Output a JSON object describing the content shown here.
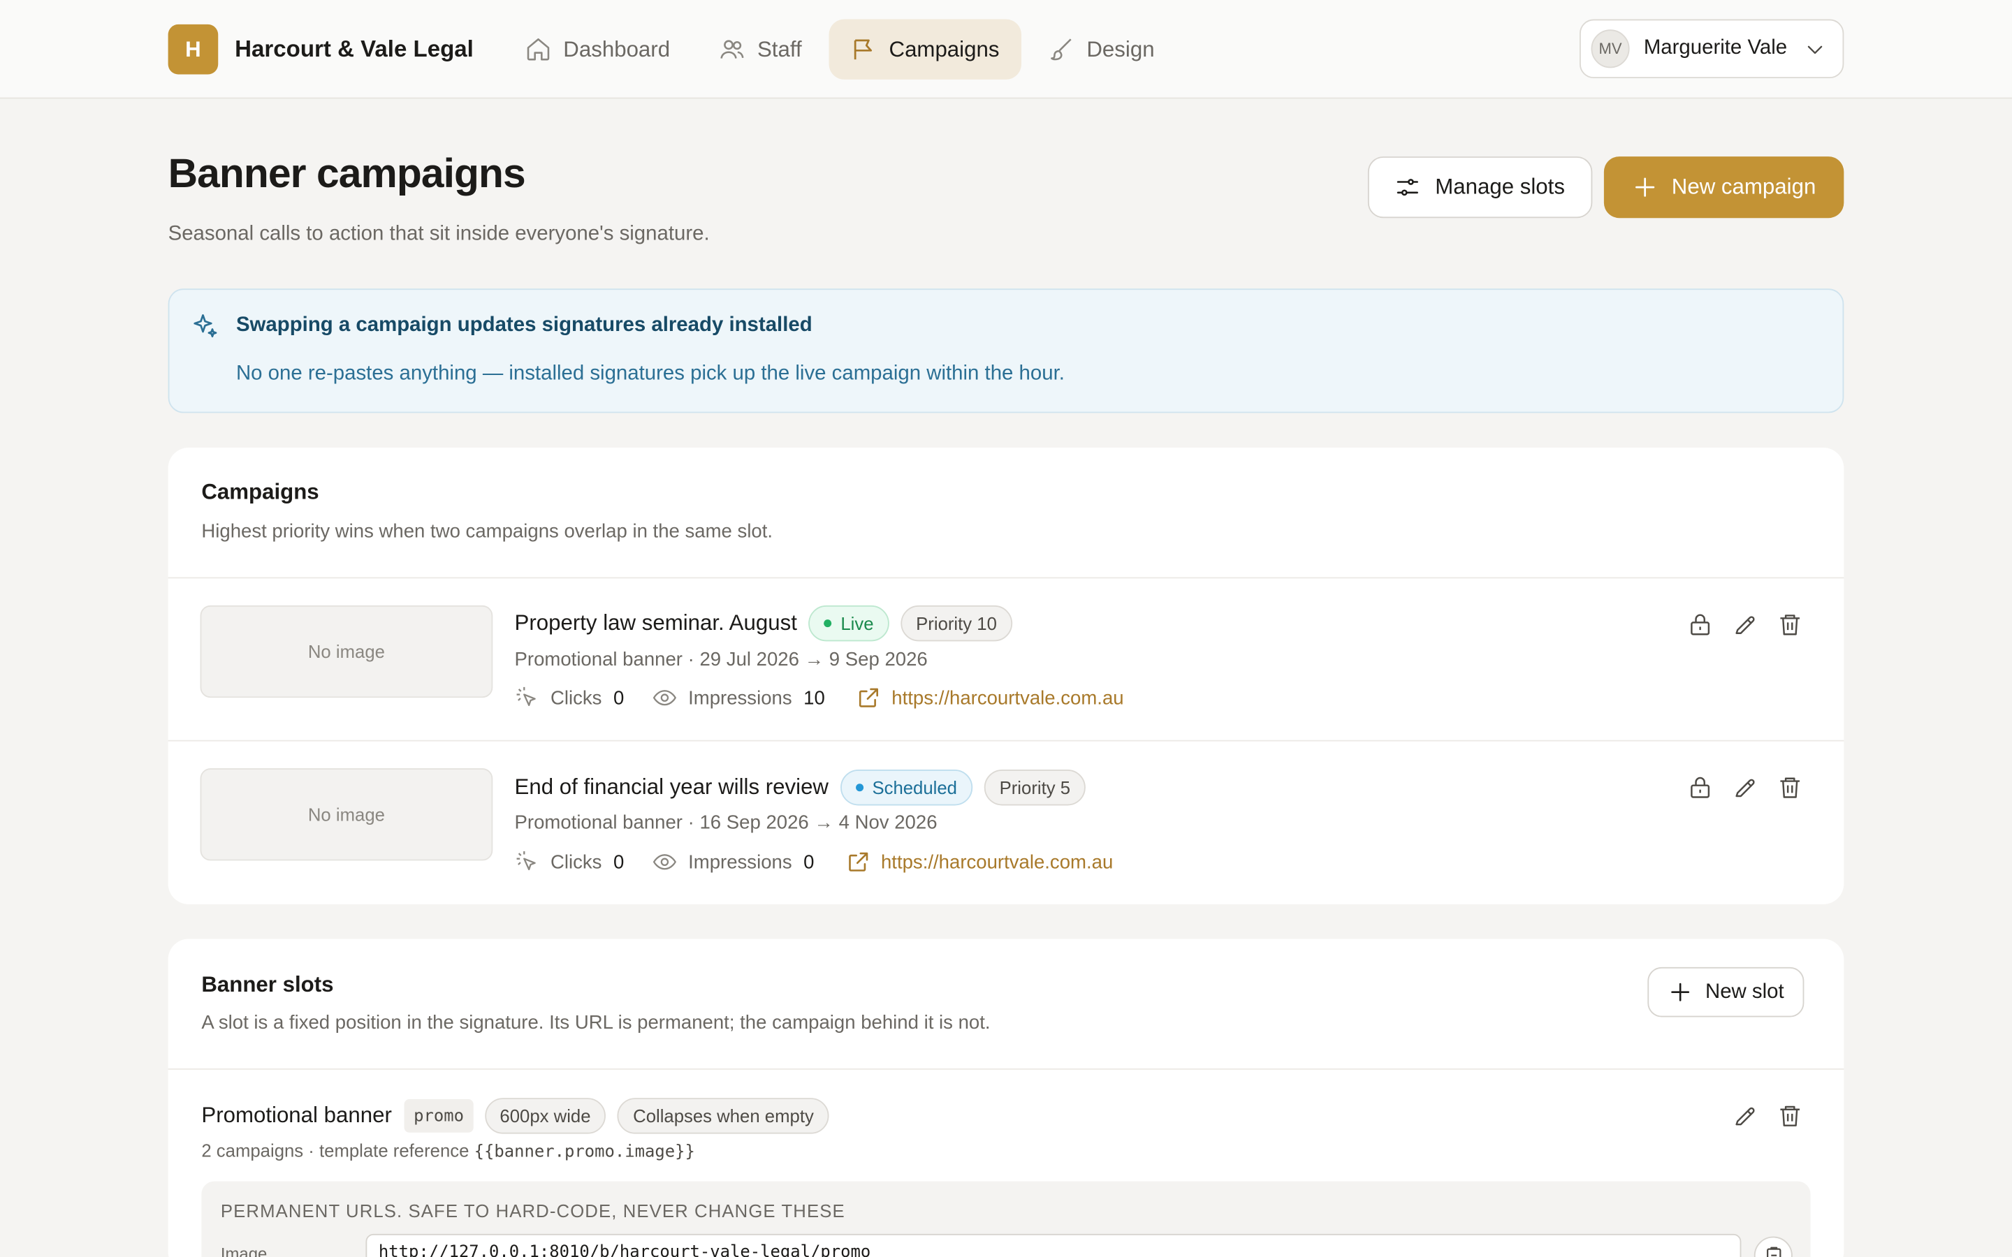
{
  "brand": {
    "initial": "H",
    "name": "Harcourt & Vale Legal"
  },
  "nav": [
    {
      "label": "Dashboard",
      "icon": "home-icon"
    },
    {
      "label": "Staff",
      "icon": "users-icon"
    },
    {
      "label": "Campaigns",
      "icon": "flag-icon",
      "active": true
    },
    {
      "label": "Design",
      "icon": "brush-icon"
    }
  ],
  "user": {
    "initials": "MV",
    "name": "Marguerite Vale"
  },
  "header": {
    "title": "Banner campaigns",
    "subtitle": "Seasonal calls to action that sit inside everyone's signature.",
    "manage_slots_label": "Manage slots",
    "new_campaign_label": "New campaign"
  },
  "info": {
    "title": "Swapping a campaign updates signatures already installed",
    "body": "No one re-pastes anything — installed signatures pick up the live campaign within the hour."
  },
  "campaigns": {
    "title": "Campaigns",
    "subtitle": "Highest priority wins when two campaigns overlap in the same slot.",
    "items": [
      {
        "thumb": "No image",
        "name": "Property law seminar. August",
        "status": "Live",
        "priority": "Priority 10",
        "slot": "Promotional banner",
        "dates": "29 Jul 2026 → 9 Sep 2026",
        "clicks_label": "Clicks",
        "clicks": "0",
        "impressions_label": "Impressions",
        "impressions": "10",
        "url": "https://harcourtvale.com.au"
      },
      {
        "thumb": "No image",
        "name": "End of financial year wills review",
        "status": "Scheduled",
        "priority": "Priority 5",
        "slot": "Promotional banner",
        "dates": "16 Sep 2026 → 4 Nov 2026",
        "clicks_label": "Clicks",
        "clicks": "0",
        "impressions_label": "Impressions",
        "impressions": "0",
        "url": "https://harcourtvale.com.au"
      }
    ]
  },
  "slots": {
    "title": "Banner slots",
    "subtitle": "A slot is a fixed position in the signature. Its URL is permanent; the campaign behind it is not.",
    "new_slot_label": "New slot",
    "items": [
      {
        "name": "Promotional banner",
        "key": "promo",
        "width": "600px wide",
        "behavior": "Collapses when empty",
        "meta_prefix": "2 campaigns · template reference ",
        "reference": "{{banner.promo.image}}",
        "urls_heading": "PERMANENT URLS. SAFE TO HARD-CODE, NEVER CHANGE THESE",
        "image_label": "Image",
        "image_url": "http://127.0.0.1:8010/b/harcourt-vale-legal/promo"
      }
    ]
  },
  "colors": {
    "accent": "#c39335",
    "live": "#1b8a4d",
    "scheduled": "#1b6f98",
    "link": "#a8792a"
  }
}
